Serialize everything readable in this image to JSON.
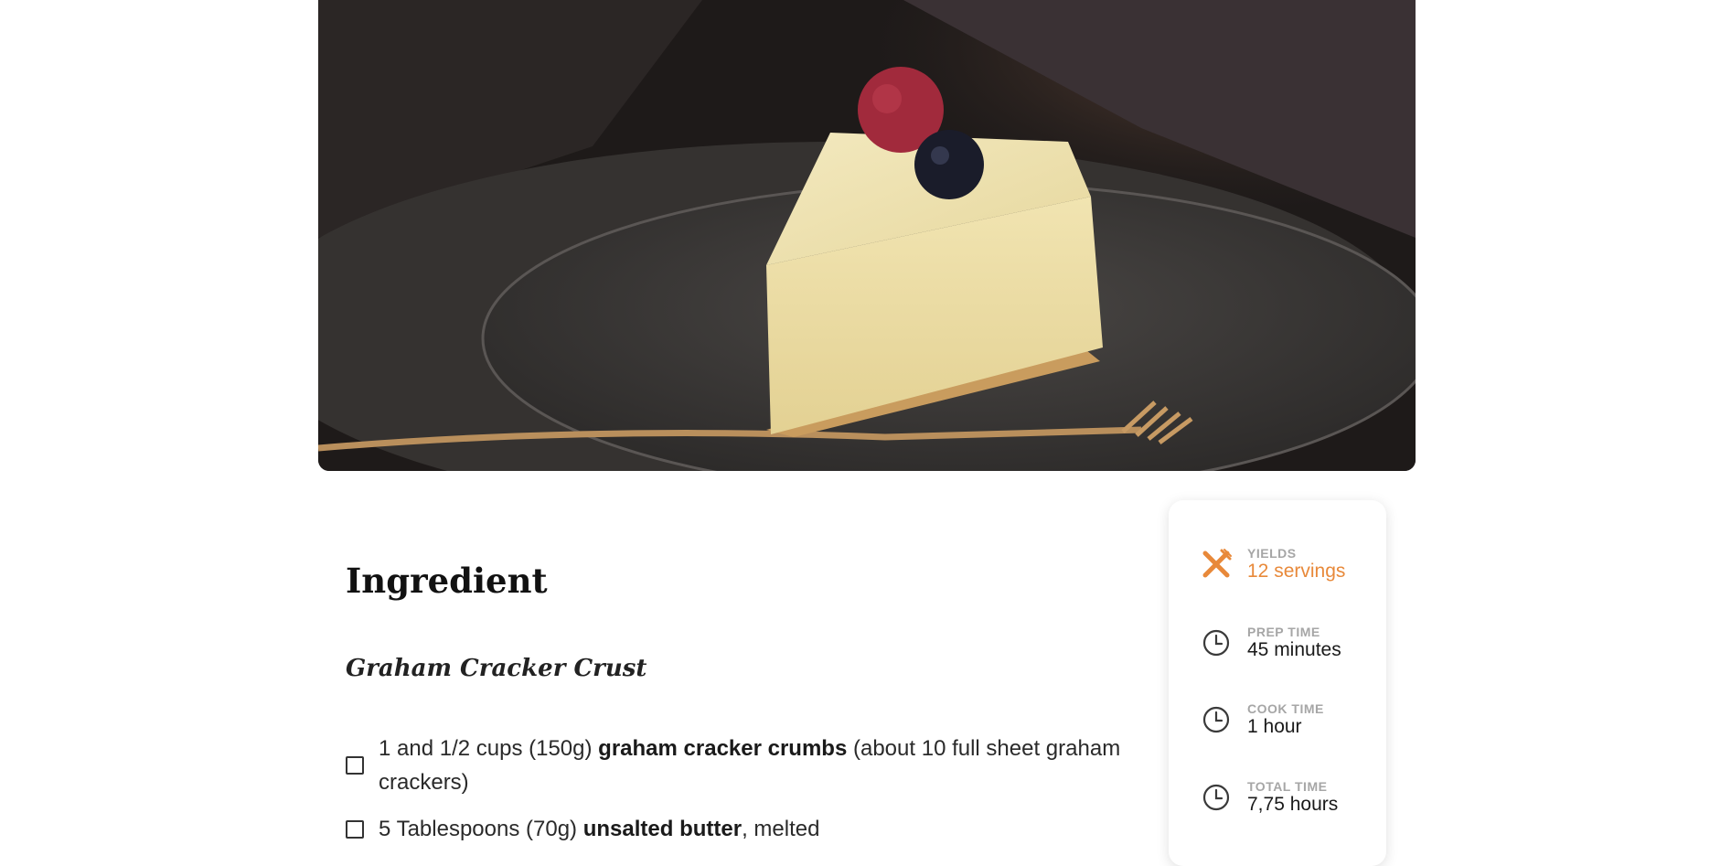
{
  "hero": {
    "image": "cheesecake-slice-photo",
    "description_icon": "photo"
  },
  "ingredients_section": {
    "title": "Ingredient",
    "groups": [
      {
        "title": "Graham Cracker Crust",
        "items": [
          {
            "before": "1 and 1/2 cups (150g) ",
            "bold": "graham cracker crumbs",
            "after": " (about 10 full sheet graham crackers)"
          },
          {
            "before": "5 Tablespoons (70g) ",
            "bold": "unsalted butter",
            "after": ", melted"
          }
        ]
      }
    ]
  },
  "info_card": {
    "yields": {
      "label": "YIELDS",
      "value": "12 servings",
      "icon": "utensils-icon"
    },
    "prep_time": {
      "label": "PREP TIME",
      "value": "45 minutes",
      "icon": "clock-icon"
    },
    "cook_time": {
      "label": "COOK TIME",
      "value": "1 hour",
      "icon": "clock-icon"
    },
    "total_time": {
      "label": "TOTAL TIME",
      "value": "7,75 hours",
      "icon": "clock-icon"
    }
  },
  "colors": {
    "accent": "#e8893a",
    "label_gray": "#a6a6a6",
    "text_dark": "#1a1a1a"
  }
}
